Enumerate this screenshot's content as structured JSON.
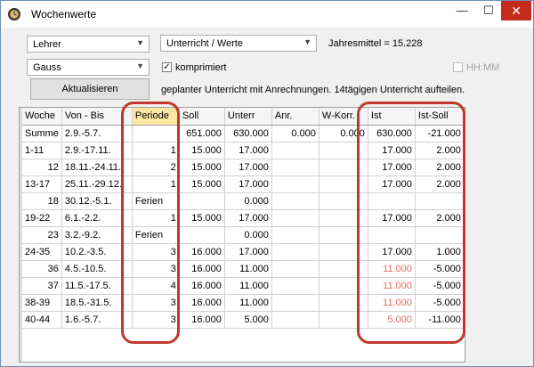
{
  "window": {
    "title": "Wochenwerte",
    "minimize": "—",
    "maximize": "☐",
    "close": "✕"
  },
  "controls": {
    "teacher_combo": "Lehrer",
    "mode_combo": "Unterricht / Werte",
    "year_avg": "Jahresmittel = 15.228",
    "method_combo": "Gauss",
    "compressed_label": "komprimiert",
    "compressed_checked": true,
    "hhmm_label": "HH:MM",
    "refresh_button": "Aktualisieren",
    "info_text": "geplanter Unterricht mit Anrechnungen. 14tägigen Unterricht aufteilen."
  },
  "table": {
    "columns": [
      "Woche",
      "Von - Bis",
      "Periode",
      "Soll",
      "Unterr",
      "Anr.",
      "W-Korr.",
      "Ist",
      "Ist-Soll"
    ],
    "rows": [
      [
        "Summe",
        "2.9.-5.7.",
        "",
        "651.000",
        "630.000",
        "0.000",
        "0.000",
        "630.000",
        "-21.000"
      ],
      [
        "1-11",
        "2.9.-17.11.",
        "1",
        "15.000",
        "17.000",
        "",
        "",
        "17.000",
        "2.000"
      ],
      [
        "12",
        "18.11.-24.11.",
        "2",
        "15.000",
        "17.000",
        "",
        "",
        "17.000",
        "2.000"
      ],
      [
        "13-17",
        "25.11.-29.12.",
        "1",
        "15.000",
        "17.000",
        "",
        "",
        "17.000",
        "2.000"
      ],
      [
        "18",
        "30.12.-5.1.",
        "Ferien",
        "",
        "0.000",
        "",
        "",
        "",
        ""
      ],
      [
        "19-22",
        "6.1.-2.2.",
        "1",
        "15.000",
        "17.000",
        "",
        "",
        "17.000",
        "2.000"
      ],
      [
        "23",
        "3.2.-9.2.",
        "Ferien",
        "",
        "0.000",
        "",
        "",
        "",
        ""
      ],
      [
        "24-35",
        "10.2.-3.5.",
        "3",
        "16.000",
        "17.000",
        "",
        "",
        "17.000",
        "1.000"
      ],
      [
        "36",
        "4.5.-10.5.",
        "3",
        "16.000",
        "11.000",
        "",
        "",
        "11.000",
        "-5.000"
      ],
      [
        "37",
        "11.5.-17.5.",
        "4",
        "16.000",
        "11.000",
        "",
        "",
        "11.000",
        "-5.000"
      ],
      [
        "38-39",
        "18.5.-31.5.",
        "3",
        "16.000",
        "11.000",
        "",
        "",
        "11.000",
        "-5.000"
      ],
      [
        "40-44",
        "1.6.-5.7.",
        "3",
        "16.000",
        "5.000",
        "",
        "",
        "5.000",
        "-11.000"
      ]
    ],
    "red_ist_rows": [
      8,
      9,
      10,
      11
    ]
  },
  "colors": {
    "highlight": "#c0392b",
    "header_selected": "#fbe6a2",
    "red_value": "#e07060"
  }
}
